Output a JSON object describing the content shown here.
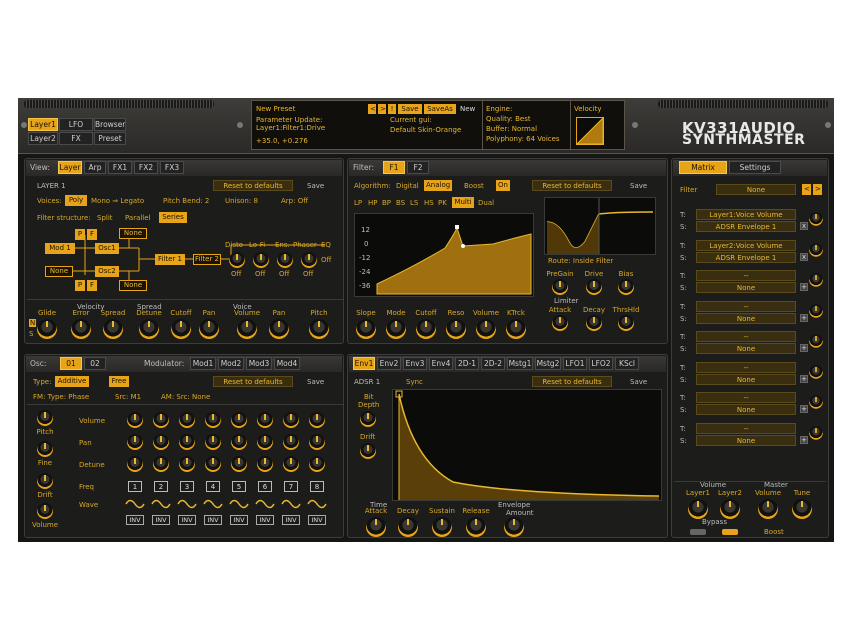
{
  "top": {
    "tabs": [
      "Layer1",
      "LFO",
      "Browser",
      "Layer2",
      "FX",
      "Preset"
    ],
    "preset_name": "New Preset",
    "param_update": "Parameter Update:",
    "param_line": "Layer1:Filter1:Drive",
    "param_value": "+35.0, +0.276",
    "btns": [
      "<",
      ">",
      "!",
      "Save",
      "SaveAs",
      "New"
    ],
    "current_gui_label": "Current gui:",
    "current_gui": "Default Skin-Orange",
    "engine": "Engine:",
    "quality": "Quality: Best",
    "buffer": "Buffer:  Normal",
    "polyphony": "Polyphony:  64 Voices",
    "velocity": "Velocity",
    "logo1": "KV331AUDIO",
    "logo2": "SYNTHMASTER"
  },
  "layer": {
    "view_label": "View:",
    "view_tabs": [
      "Layer",
      "Arp",
      "FX1",
      "FX2",
      "FX3"
    ],
    "title": "LAYER 1",
    "reset": "Reset to defaults",
    "save": "Save",
    "voices_label": "Voices:",
    "voices_val": "Poly",
    "mono_legato": "Mono ⇒ Legato",
    "pitch_bend": "Pitch Bend: 2",
    "unison": "Unison: 8",
    "arp": "Arp:  Off",
    "filter_structure": "Filter structure:",
    "split": "Split",
    "parallel": "Parallel",
    "series": "Series",
    "mod1": "Mod 1",
    "osc1": "Osc1",
    "none": "None",
    "osc2": "Osc2",
    "filter1": "Filter 1",
    "filter2": "Filter 2",
    "p": "P",
    "f": "F",
    "fx_labels": [
      "Disto",
      "Lo-Fi",
      "Ens.",
      "Phaser",
      "EQ"
    ],
    "off": "Off",
    "knobs": [
      "Glide",
      "Error",
      "Spread",
      "Detune",
      "Cutoff",
      "Pan",
      "Volume",
      "Pan",
      "Pitch"
    ],
    "groups": [
      "Velocity",
      "Spread",
      "Voice"
    ],
    "n": "N",
    "s": "S"
  },
  "filter": {
    "label": "Filter:",
    "tabs": [
      "F1",
      "F2"
    ],
    "algorithm": "Algorithm:",
    "digital": "Digital",
    "analog": "Analog",
    "boost": "Boost",
    "on": "On",
    "reset": "Reset to defaults",
    "save": "Save",
    "types": [
      "LP",
      "HP",
      "BP",
      "BS",
      "LS",
      "HS",
      "PK",
      "Multi",
      "Dual"
    ],
    "yticks": [
      "12",
      "0",
      "-12",
      "-24",
      "-36"
    ],
    "route": "Route:  Inside Filter",
    "k1": [
      "PreGain",
      "Drive",
      "Bias"
    ],
    "limiter": "Limiter",
    "k2": [
      "Attack",
      "Decay",
      "ThrsHld"
    ],
    "knobs": [
      "Slope",
      "Mode",
      "Cutoff",
      "Reso",
      "Volume",
      "KTrck"
    ]
  },
  "osc": {
    "label": "Osc:",
    "tabs": [
      "01",
      "02"
    ],
    "modulator": "Modulator:",
    "mods": [
      "Mod1",
      "Mod2",
      "Mod3",
      "Mod4"
    ],
    "type_label": "Type:",
    "type_val": "Additive",
    "free": "Free",
    "reset": "Reset to defaults",
    "save": "Save",
    "fm": "FM: Type: Phase",
    "src": "Src: M1",
    "am": "AM: Src: None",
    "left": [
      "Pitch",
      "Fine",
      "Drift",
      "Volume"
    ],
    "rows": [
      "Volume",
      "Pan",
      "Detune",
      "Freq",
      "Wave"
    ],
    "nums": [
      "1",
      "2",
      "3",
      "4",
      "5",
      "6",
      "7",
      "8"
    ],
    "inv": "INV"
  },
  "env": {
    "tabs": [
      "Env1",
      "Env2",
      "Env3",
      "Env4",
      "2D-1",
      "2D-2",
      "Mstg1",
      "Mstg2",
      "LFO1",
      "LFO2",
      "KScl"
    ],
    "title": "ADSR 1",
    "sync": "Sync",
    "reset": "Reset to defaults",
    "save": "Save",
    "bit_depth1": "Bit",
    "bit_depth2": "Depth",
    "drift": "Drift",
    "time": "Time",
    "envamt1": "Envelope",
    "envamt2": "Amount",
    "knobs": [
      "Attack",
      "Decay",
      "Sustain",
      "Release"
    ]
  },
  "matrix": {
    "tabs": [
      "Matrix",
      "Settings"
    ],
    "filter_label": "Filter",
    "filter_val": "None",
    "t1": "Layer1:Voice Volume",
    "s1": "ADSR Envelope 1",
    "t2": "Layer2:Voice Volume",
    "s2": "ADSR Envelope 1",
    "empty": "--",
    "none": "None",
    "T": "T:",
    "S": "S:",
    "x": "x",
    "plus": "+",
    "footer_groups": [
      "Volume",
      "Master"
    ],
    "footer_knobs": [
      "Layer1",
      "Layer2",
      "Volume",
      "Tune"
    ],
    "bypass": "Bypass",
    "boost": "Boost"
  }
}
